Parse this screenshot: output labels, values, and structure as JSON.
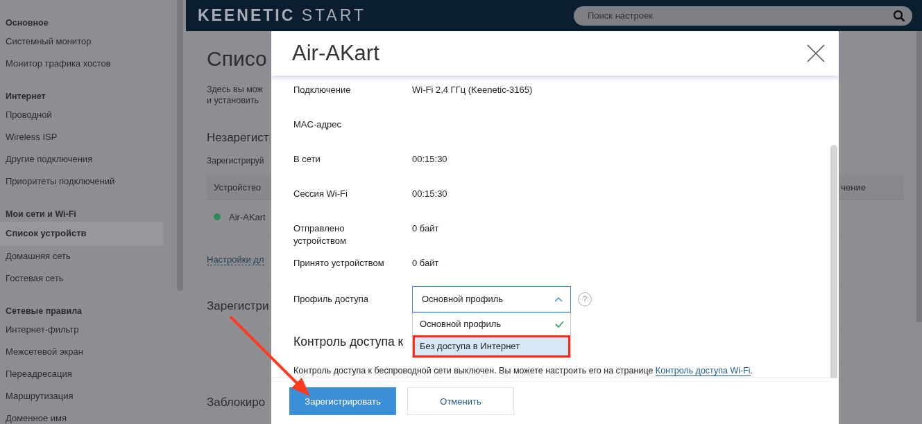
{
  "sidebar": {
    "sections": [
      {
        "title": "Основное",
        "items": [
          {
            "label": "Системный монитор",
            "selected": false
          },
          {
            "label": "Монитор трафика хостов",
            "selected": false
          }
        ]
      },
      {
        "title": "Интернет",
        "items": [
          {
            "label": "Проводной",
            "selected": false
          },
          {
            "label": "Wireless ISP",
            "selected": false
          },
          {
            "label": "Другие подключения",
            "selected": false
          },
          {
            "label": "Приоритеты подключений",
            "selected": false
          }
        ]
      },
      {
        "title": "Мои сети и Wi-Fi",
        "items": [
          {
            "label": "Список устройств",
            "selected": true
          },
          {
            "label": "Домашняя сеть",
            "selected": false
          },
          {
            "label": "Гостевая сеть",
            "selected": false
          }
        ]
      },
      {
        "title": "Сетевые правила",
        "items": [
          {
            "label": "Интернет-фильтр",
            "selected": false
          },
          {
            "label": "Межсетевой экран",
            "selected": false
          },
          {
            "label": "Переадресация",
            "selected": false
          },
          {
            "label": "Маршрутизация",
            "selected": false
          },
          {
            "label": "Доменное имя",
            "selected": false
          }
        ]
      }
    ]
  },
  "header": {
    "logo_bold": "KEENETIC",
    "logo_light": "START",
    "search": {
      "placeholder": "Поиск настроек"
    }
  },
  "page": {
    "title": "Списо",
    "description": [
      "Здесь вы мож",
      "и установить"
    ],
    "unregistered_title": "Незарегист",
    "unregistered_hint": "Зарегистрируй",
    "table": {
      "columns": [
        "Устройство",
        "чение"
      ],
      "rows": [
        {
          "name": "Air-AKart",
          "color": "#2e8b57"
        }
      ]
    },
    "settings_link": "Настройки дл",
    "registered_title": "Зарегистри",
    "blocked_title": "Заблокиро"
  },
  "modal": {
    "title": "Air-AKart",
    "fields": [
      {
        "label": "Подключение",
        "value": "Wi-Fi 2,4 ГГц (Keenetic-3165)"
      },
      {
        "label": "MAC-адрес"
      },
      {
        "label": "В сети",
        "value": "00:15:30"
      },
      {
        "label": "Сессия Wi-Fi",
        "value": "00:15:30"
      },
      {
        "label": "Отправлено устройством",
        "value": "0 байт"
      },
      {
        "label": "Принято устройством",
        "value": "0 байт"
      }
    ],
    "profile": {
      "label": "Профиль доступа",
      "value": "Основной профиль",
      "expanded": true,
      "help": "?",
      "options": [
        {
          "label": "Основной профиль",
          "selected": true,
          "highlighted": false
        },
        {
          "label": "Без доступа в Интернет",
          "selected": false,
          "highlighted": true
        }
      ]
    },
    "access_title": "Контроль доступа к",
    "access_text": "Контроль доступа к беспроводной сети выключен. Вы можете настроить его на странице ",
    "access_link": "Контроль доступа Wi-Fi",
    "access_end": ".",
    "buttons": [
      {
        "label": "Зарегистрировать",
        "kind": "primary"
      },
      {
        "label": "Отменить",
        "kind": "secondary"
      }
    ]
  }
}
